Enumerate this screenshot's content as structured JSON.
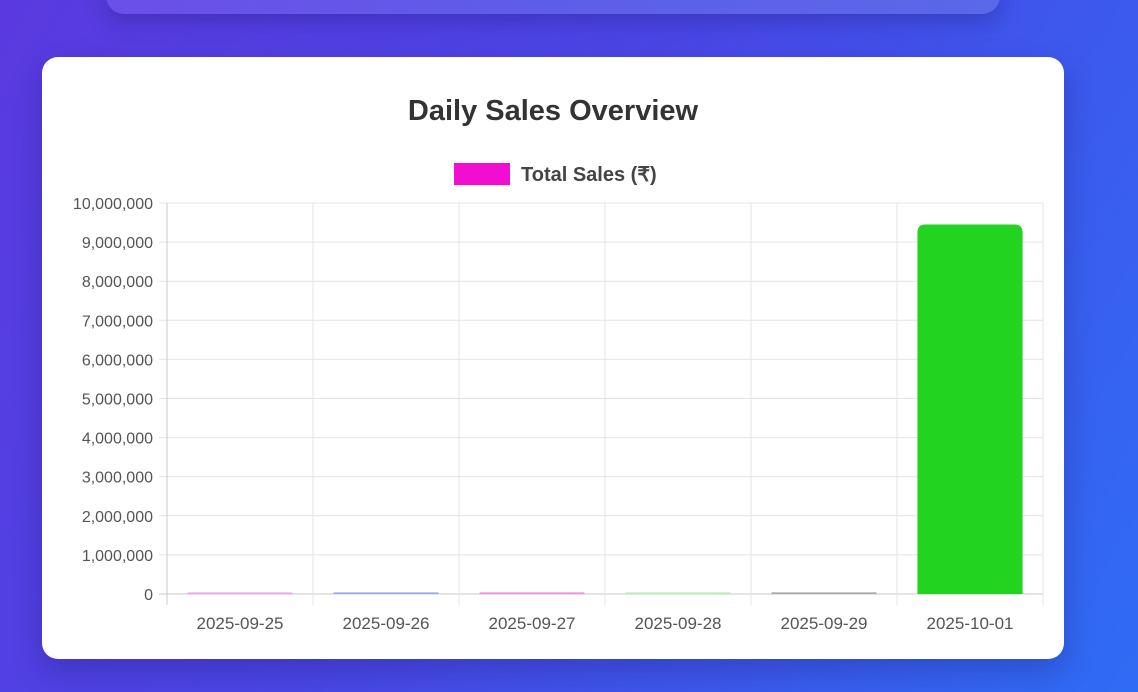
{
  "chart_data": {
    "type": "bar",
    "title": "Daily Sales Overview",
    "legend": {
      "label": "Total Sales (₹)",
      "color": "#f20dd0",
      "placement": "top-center"
    },
    "categories": [
      "2025-09-25",
      "2025-09-26",
      "2025-09-27",
      "2025-09-28",
      "2025-09-29",
      "2025-10-01"
    ],
    "series": [
      {
        "name": "Total Sales (₹)",
        "values": [
          40000,
          40000,
          40000,
          40000,
          40000,
          9450000
        ],
        "colors": [
          "#f3a6ef",
          "#9aa6ee",
          "#f08fe0",
          "#b8eeb8",
          "#a6a6a6",
          "#22d31f"
        ]
      }
    ],
    "y_ticks": [
      "0",
      "1,000,000",
      "2,000,000",
      "3,000,000",
      "4,000,000",
      "5,000,000",
      "6,000,000",
      "7,000,000",
      "8,000,000",
      "9,000,000",
      "10,000,000"
    ],
    "ylim": [
      0,
      10000000
    ],
    "xlabel": "",
    "ylabel": "",
    "grid": true
  }
}
